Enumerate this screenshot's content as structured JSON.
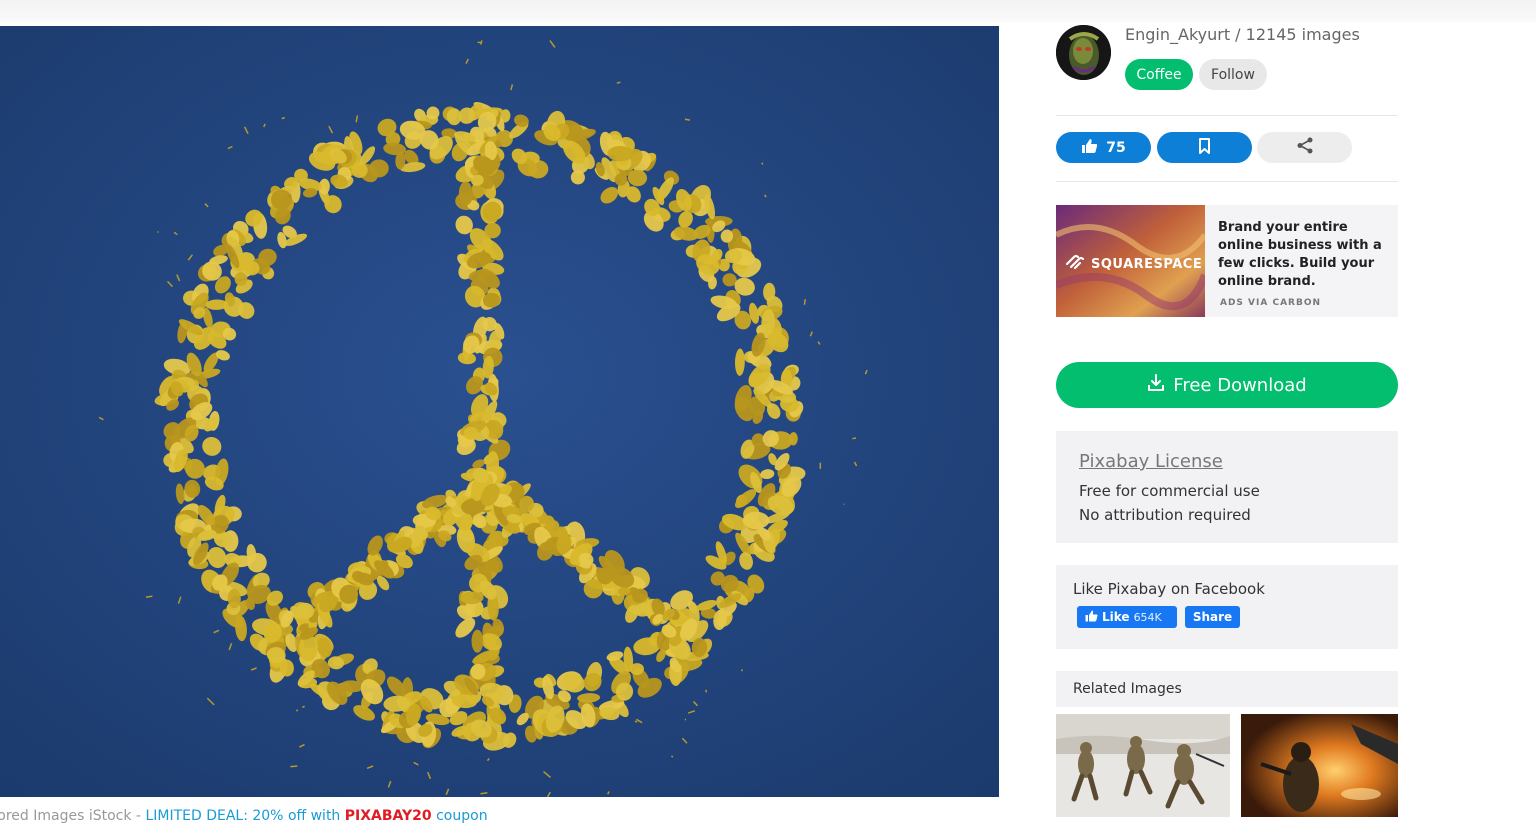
{
  "image": {
    "alt": "peace sign made of yellow petals on blue background"
  },
  "sponsored": {
    "prefix": "sored Images iStock - ",
    "deal": "LIMITED DEAL: 20% off with ",
    "code": "PIXABAY20",
    "suffix": " coupon"
  },
  "user": {
    "name_line": "Engin_Akyurt / 12145 images",
    "coffee_label": "Coffee",
    "follow_label": "Follow"
  },
  "actions": {
    "likes_count": "75",
    "like_icon": "thumbs-up-icon",
    "save_icon": "bookmark-icon",
    "share_icon": "share-icon"
  },
  "ad": {
    "brand": "SQUARESPACE",
    "text": "Brand your entire online business with a few clicks. Build your online brand.",
    "via": "ADS VIA CARBON"
  },
  "download": {
    "label": "Free Download",
    "icon": "download-icon"
  },
  "license": {
    "title": "Pixabay License",
    "line1": "Free for commercial use",
    "line2": "No attribution required"
  },
  "facebook": {
    "label": "Like Pixabay on Facebook",
    "like_label": "Like",
    "like_count": "654K",
    "share_label": "Share"
  },
  "related": {
    "label": "Related Images"
  },
  "colors": {
    "accent_green": "#02be6e",
    "accent_blue": "#0e7fd6",
    "facebook_blue": "#1877f2",
    "image_background": "#22447a",
    "petal_yellow": "#d9b92c"
  }
}
